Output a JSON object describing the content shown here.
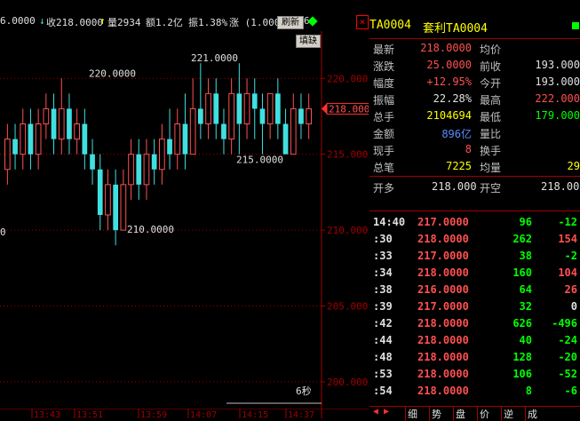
{
  "topbar": {
    "price_text": "6.0000",
    "close_label": "收218.0000",
    "volume_label": "量2934",
    "amount_label": "额1.2亿",
    "amplitude_label": "振1.38%",
    "rise_label": "涨 (1.000",
    "refresh_label": "刷新",
    "six": "6",
    "close_x": "×"
  },
  "chart": {
    "right_labels": [
      "220.0000",
      "215.0000",
      "210.0000",
      "205.0000",
      "200.0000"
    ],
    "current_price_label": "218.0000",
    "annotations": {
      "high1": "220.0000",
      "high2": "221.0000",
      "mid": "215.0000",
      "low": "210.0000"
    },
    "fill_gap_label": "填缺",
    "interval_label": "6秒",
    "left_stub": "0",
    "up_color": "#ff5050",
    "down_color": "#40e0e0"
  },
  "chart_data": {
    "type": "candlestick",
    "xlabel": "",
    "ylabel": "",
    "ylim": [
      199,
      223
    ],
    "x_ticks": [
      "13:43",
      "13:51",
      "13:59",
      "14:07",
      "14:15",
      "14:37"
    ],
    "y_ticks": [
      "220.0000",
      "215.0000",
      "210.0000",
      "205.0000",
      "200.0000"
    ],
    "candles": [
      {
        "o": 214,
        "c": 216,
        "h": 217,
        "l": 213
      },
      {
        "o": 216,
        "c": 215,
        "h": 217,
        "l": 214
      },
      {
        "o": 215,
        "c": 217,
        "h": 218,
        "l": 214
      },
      {
        "o": 217,
        "c": 215,
        "h": 218,
        "l": 214
      },
      {
        "o": 215,
        "c": 217,
        "h": 218,
        "l": 214
      },
      {
        "o": 217,
        "c": 218,
        "h": 219,
        "l": 216
      },
      {
        "o": 218,
        "c": 216,
        "h": 219,
        "l": 215
      },
      {
        "o": 216,
        "c": 218,
        "h": 220,
        "l": 215
      },
      {
        "o": 218,
        "c": 216,
        "h": 219,
        "l": 215
      },
      {
        "o": 216,
        "c": 217,
        "h": 218,
        "l": 215
      },
      {
        "o": 217,
        "c": 215,
        "h": 218,
        "l": 214
      },
      {
        "o": 215,
        "c": 214,
        "h": 216,
        "l": 213
      },
      {
        "o": 214,
        "c": 211,
        "h": 215,
        "l": 210
      },
      {
        "o": 211,
        "c": 213,
        "h": 214,
        "l": 210
      },
      {
        "o": 213,
        "c": 210,
        "h": 214,
        "l": 209
      },
      {
        "o": 210,
        "c": 213,
        "h": 214,
        "l": 210
      },
      {
        "o": 213,
        "c": 215,
        "h": 216,
        "l": 212
      },
      {
        "o": 215,
        "c": 213,
        "h": 216,
        "l": 212
      },
      {
        "o": 213,
        "c": 215,
        "h": 216,
        "l": 212
      },
      {
        "o": 215,
        "c": 214,
        "h": 216,
        "l": 213
      },
      {
        "o": 214,
        "c": 216,
        "h": 217,
        "l": 213
      },
      {
        "o": 216,
        "c": 215,
        "h": 218,
        "l": 214
      },
      {
        "o": 215,
        "c": 217,
        "h": 218,
        "l": 214
      },
      {
        "o": 217,
        "c": 215,
        "h": 219,
        "l": 214
      },
      {
        "o": 215,
        "c": 218,
        "h": 220,
        "l": 215
      },
      {
        "o": 218,
        "c": 217,
        "h": 221,
        "l": 216
      },
      {
        "o": 217,
        "c": 219,
        "h": 220,
        "l": 216
      },
      {
        "o": 219,
        "c": 217,
        "h": 220,
        "l": 216
      },
      {
        "o": 217,
        "c": 216,
        "h": 218,
        "l": 215
      },
      {
        "o": 216,
        "c": 219,
        "h": 220,
        "l": 215
      },
      {
        "o": 219,
        "c": 217,
        "h": 221,
        "l": 215
      },
      {
        "o": 217,
        "c": 219,
        "h": 220,
        "l": 216
      },
      {
        "o": 219,
        "c": 218,
        "h": 220,
        "l": 216
      },
      {
        "o": 218,
        "c": 217,
        "h": 219,
        "l": 215
      },
      {
        "o": 217,
        "c": 219,
        "h": 219,
        "l": 216
      },
      {
        "o": 219,
        "c": 217,
        "h": 220,
        "l": 216
      },
      {
        "o": 217,
        "c": 215,
        "h": 218,
        "l": 215
      },
      {
        "o": 215,
        "c": 218,
        "h": 219,
        "l": 215
      },
      {
        "o": 218,
        "c": 217,
        "h": 219,
        "l": 216
      },
      {
        "o": 217,
        "c": 218,
        "h": 219,
        "l": 216
      }
    ]
  },
  "panel": {
    "header_code": "TA0004",
    "header_name": "套利TA0004",
    "quote_rows": [
      {
        "l1": "最新",
        "v1": "218.0000",
        "c1": "red",
        "l2": "均价",
        "v2": ""
      },
      {
        "l1": "涨跌",
        "v1": "25.0000",
        "c1": "red",
        "l2": "前收",
        "v2": "193.000",
        "c2": "white"
      },
      {
        "l1": "幅度",
        "v1": "+12.95%",
        "c1": "red",
        "l2": "今开",
        "v2": "193.000",
        "c2": "white"
      },
      {
        "l1": "振幅",
        "v1": "22.28%",
        "c1": "white",
        "l2": "最高",
        "v2": "222.000",
        "c2": "red"
      },
      {
        "l1": "总手",
        "v1": "2104694",
        "c1": "yellow",
        "l2": "最低",
        "v2": "179.000",
        "c2": "green"
      },
      {
        "l1": "金额",
        "v1": "896亿",
        "c1": "blue",
        "l2": "量比",
        "v2": ""
      },
      {
        "l1": "现手",
        "v1": "8",
        "c1": "red",
        "l2": "换手",
        "v2": ""
      },
      {
        "l1": "总笔",
        "v1": "7225",
        "c1": "yellow",
        "l2": "均量",
        "v2": "29",
        "c2": "yellow"
      }
    ],
    "open_row": {
      "l1": "开多",
      "v1": "218.000",
      "l2": "开空",
      "v2": "218.00"
    },
    "ticks": [
      {
        "t": "14:40",
        "p": "217.0000",
        "v": "96",
        "d": "-12"
      },
      {
        "t": ":30",
        "p": "218.0000",
        "v": "262",
        "d": "154"
      },
      {
        "t": ":33",
        "p": "217.0000",
        "v": "38",
        "d": "-2"
      },
      {
        "t": ":34",
        "p": "218.0000",
        "v": "160",
        "d": "104"
      },
      {
        "t": ":38",
        "p": "216.0000",
        "v": "64",
        "d": "26"
      },
      {
        "t": ":39",
        "p": "217.0000",
        "v": "32",
        "d": "0"
      },
      {
        "t": ":42",
        "p": "218.0000",
        "v": "626",
        "d": "-496"
      },
      {
        "t": ":44",
        "p": "218.0000",
        "v": "40",
        "d": "-24"
      },
      {
        "t": ":48",
        "p": "218.0000",
        "v": "128",
        "d": "-20"
      },
      {
        "t": ":53",
        "p": "218.0000",
        "v": "106",
        "d": "-52"
      },
      {
        "t": ":54",
        "p": "218.0000",
        "v": "8",
        "d": "-6"
      }
    ],
    "bottom_tabs": [
      "细",
      "势",
      "盘",
      "价",
      "逆",
      "成"
    ]
  }
}
